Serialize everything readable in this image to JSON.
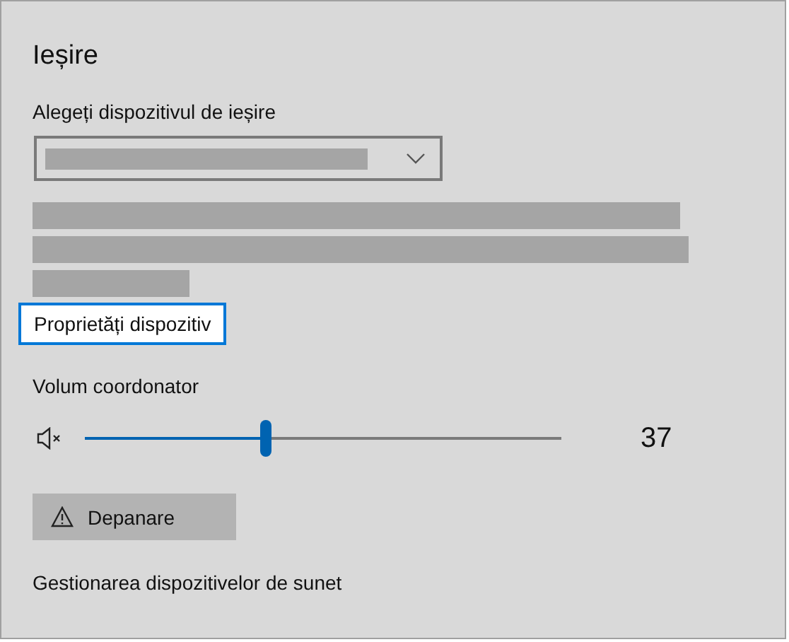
{
  "section": {
    "title": "Ieșire"
  },
  "output_device": {
    "label": "Alegeți dispozitivul de ieșire"
  },
  "device_properties_link": {
    "label": "Proprietăți dispozitiv",
    "focused": true
  },
  "master_volume": {
    "label": "Volum coordonator",
    "muted": true,
    "level": 0.37,
    "reading": "37"
  },
  "troubleshoot_button": {
    "label": "Depanare"
  },
  "manage_devices_link": {
    "label": "Gestionarea dispozitivelor de sunet"
  }
}
